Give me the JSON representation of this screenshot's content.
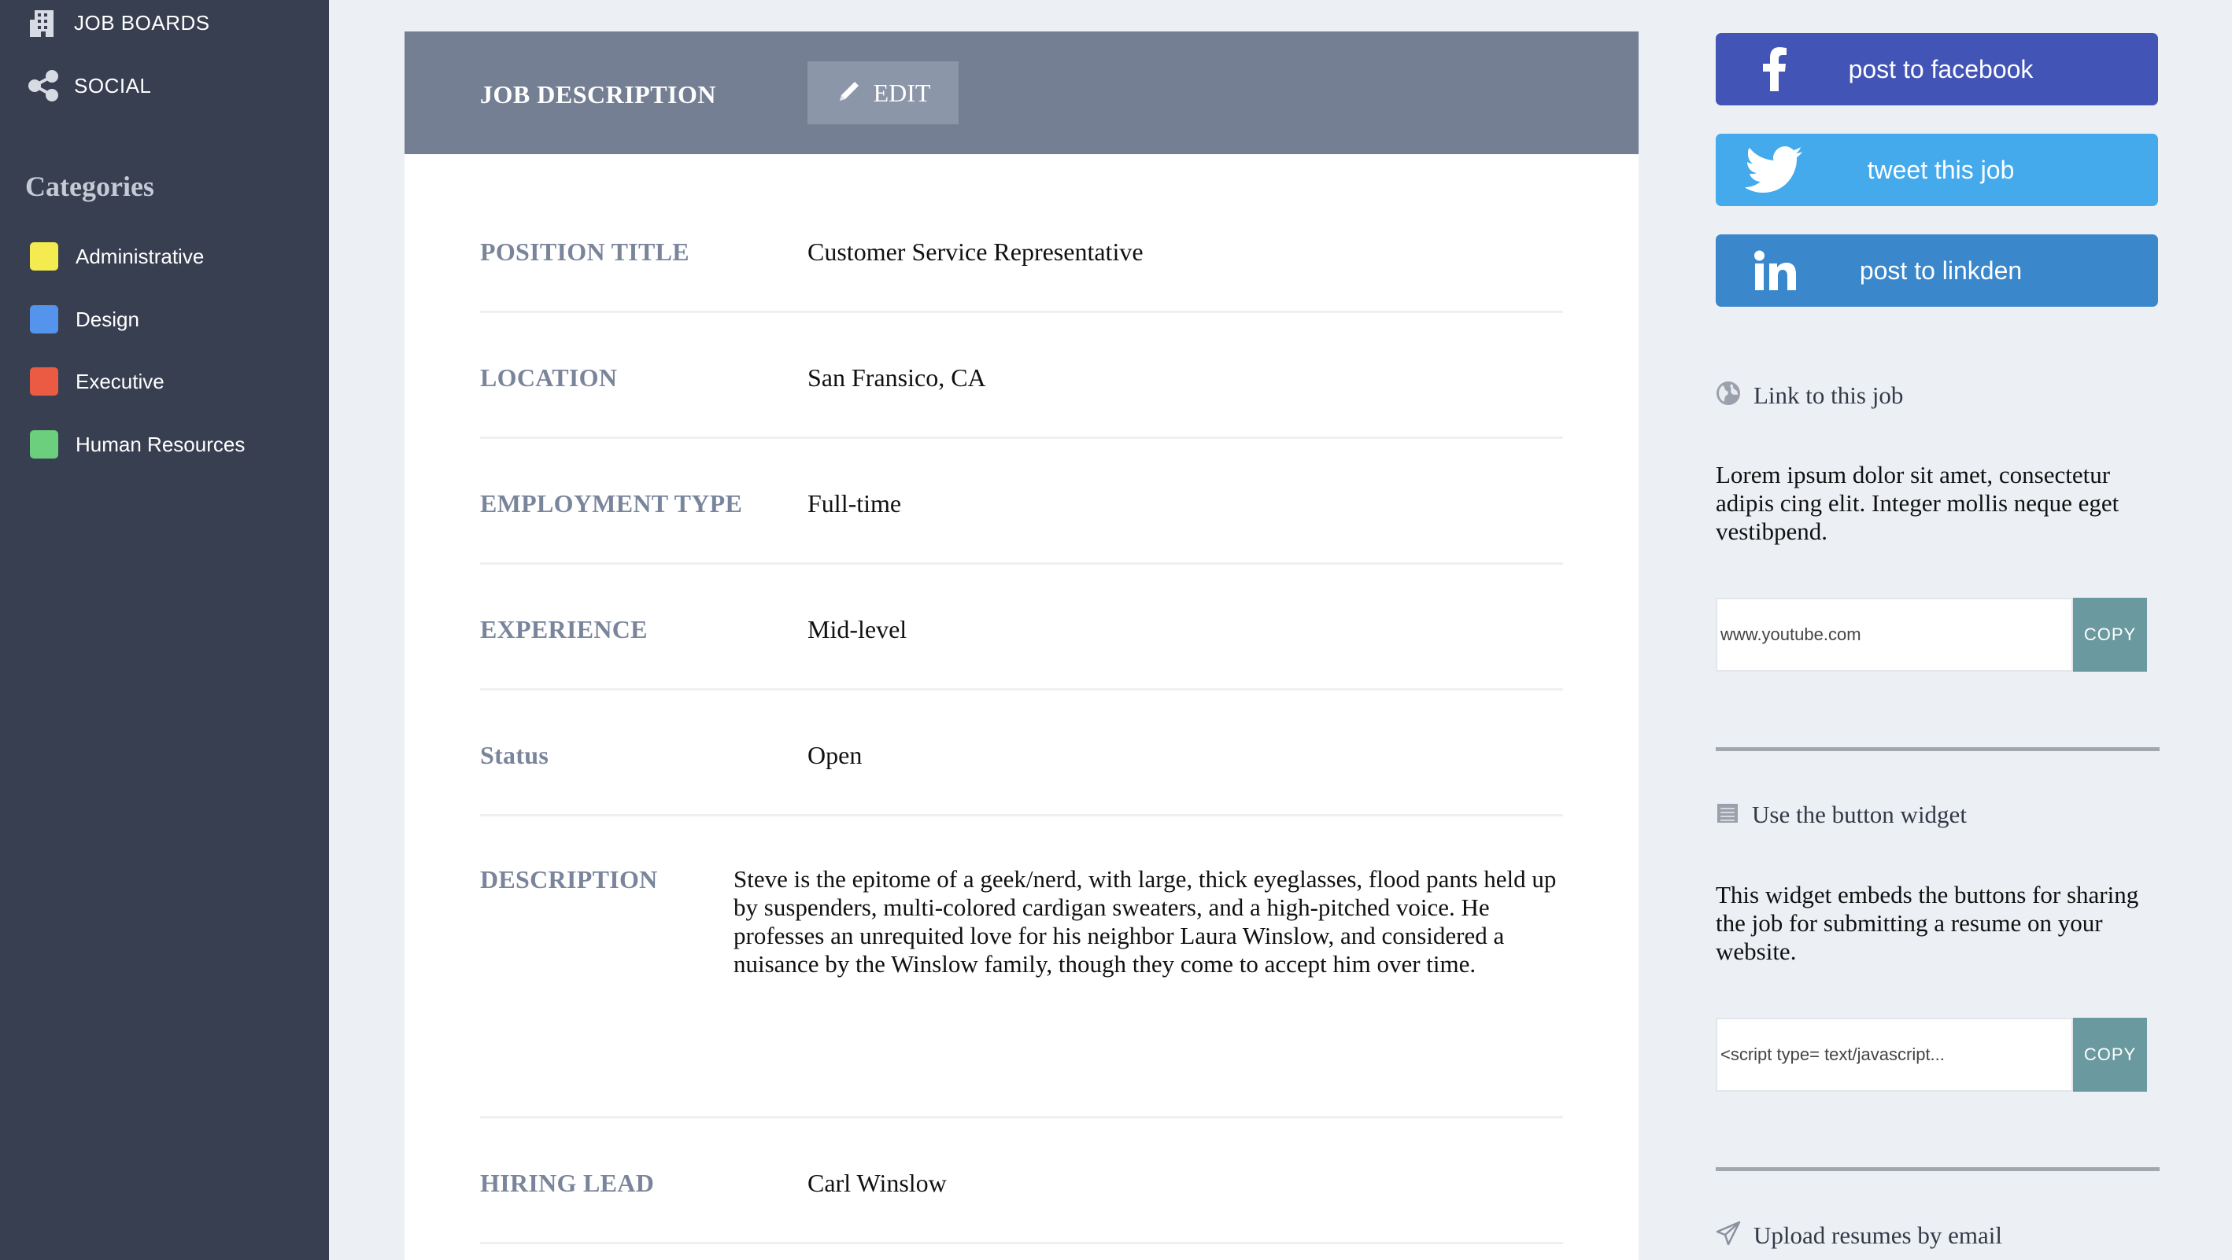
{
  "sidebar": {
    "nav": [
      {
        "label": "JOB BOARDS",
        "icon": "building-icon"
      },
      {
        "label": "SOCIAL",
        "icon": "share-nodes-icon"
      }
    ],
    "categories_heading": "Categories",
    "categories": [
      {
        "label": "Administrative",
        "color": "#f3eb4f"
      },
      {
        "label": "Design",
        "color": "#5594ec"
      },
      {
        "label": "Executive",
        "color": "#eb5b44"
      },
      {
        "label": "Human Resources",
        "color": "#6ccf7e"
      }
    ]
  },
  "job": {
    "header_title": "JOB DESCRIPTION",
    "edit_label": "EDIT",
    "fields": [
      {
        "label": "POSITION TITLE",
        "value": "Customer Service Representative"
      },
      {
        "label": "LOCATION",
        "value": "San Fransico, CA"
      },
      {
        "label": "EMPLOYMENT TYPE",
        "value": "Full-time"
      },
      {
        "label": "EXPERIENCE",
        "value": "Mid-level"
      },
      {
        "label": "Status",
        "value": "Open"
      }
    ],
    "description_label": "DESCRIPTION",
    "description_text": "Steve is the epitome of a geek/nerd, with large, thick eyeglasses, flood pants held up by suspenders, multi-colored cardigan sweaters, and a high-pitched voice. He professes an unrequited love for his neighbor Laura Winslow, and considered a nuisance by the Winslow family, though they come to accept him over time.",
    "hiring_lead_label": "HIRING LEAD",
    "hiring_lead_value": "Carl Winslow"
  },
  "share": {
    "facebook": {
      "label": "post to facebook",
      "color": "#4254b5",
      "icon": "facebook-icon"
    },
    "twitter": {
      "label": "tweet this job",
      "color": "#45aaec",
      "icon": "twitter-icon"
    },
    "linkedin": {
      "label": "post to linkden",
      "color": "#3a87cc",
      "icon": "linkedin-icon"
    }
  },
  "link_section": {
    "title": "Link to this job",
    "icon": "globe-icon",
    "text": "Lorem ipsum dolor sit amet, consectetur adipis cing elit. Integer mollis neque eget vestibpend.",
    "input_value": "www.youtube.com",
    "copy_label": "COPY"
  },
  "widget_section": {
    "title": "Use the button widget",
    "icon": "widget-icon",
    "text": "This widget embeds the buttons for sharing the job for submitting a resume on your website.",
    "input_value": "<script type= text/javascript...",
    "copy_label": "COPY"
  },
  "upload_section": {
    "title": "Upload resumes by email",
    "icon": "paper-plane-icon"
  }
}
